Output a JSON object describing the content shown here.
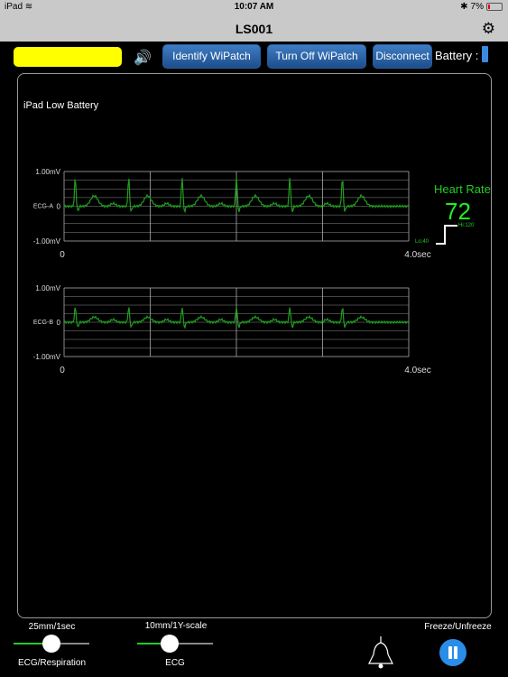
{
  "status_bar": {
    "device": "iPad",
    "time": "10:07 AM",
    "battery_percent": "7%"
  },
  "nav": {
    "title": "LS001",
    "settings_icon": "gear-icon"
  },
  "toolbar": {
    "identify_label": "Identify WiPatch",
    "turn_off_label": "Turn Off WiPatch",
    "disconnect_label": "Disconnect",
    "battery_label": "Battery :",
    "status_color": "#ffff00"
  },
  "alert": {
    "text": "iPad Low Battery"
  },
  "charts": [
    {
      "name": "ECG-A",
      "ymax_label": "1.00mV",
      "ymin_label": "-1.00mV",
      "zero_label": "0",
      "x_start": "0",
      "x_end": "4.0sec",
      "r_amp": 0.85,
      "t_amp": 0.3
    },
    {
      "name": "ECG-B",
      "ymax_label": "1.00mV",
      "ymin_label": "-1.00mV",
      "zero_label": "0",
      "x_start": "0",
      "x_end": "4.0sec",
      "r_amp": 0.45,
      "t_amp": 0.15
    }
  ],
  "heart_rate": {
    "label": "Heart Rate",
    "value": "72",
    "hi": "Hi:120",
    "lo": "Lo:40"
  },
  "controls": {
    "speed_value": "25mm/1sec",
    "speed_label": "ECG/Respiration",
    "speed_level": 0.5,
    "scale_value": "10mm/1Y-scale",
    "scale_label": "ECG",
    "scale_level": 0.4,
    "freeze_label": "Freeze/Unfreeze"
  },
  "colors": {
    "trace": "#1e9e1e",
    "accent": "#2a8ee8"
  }
}
